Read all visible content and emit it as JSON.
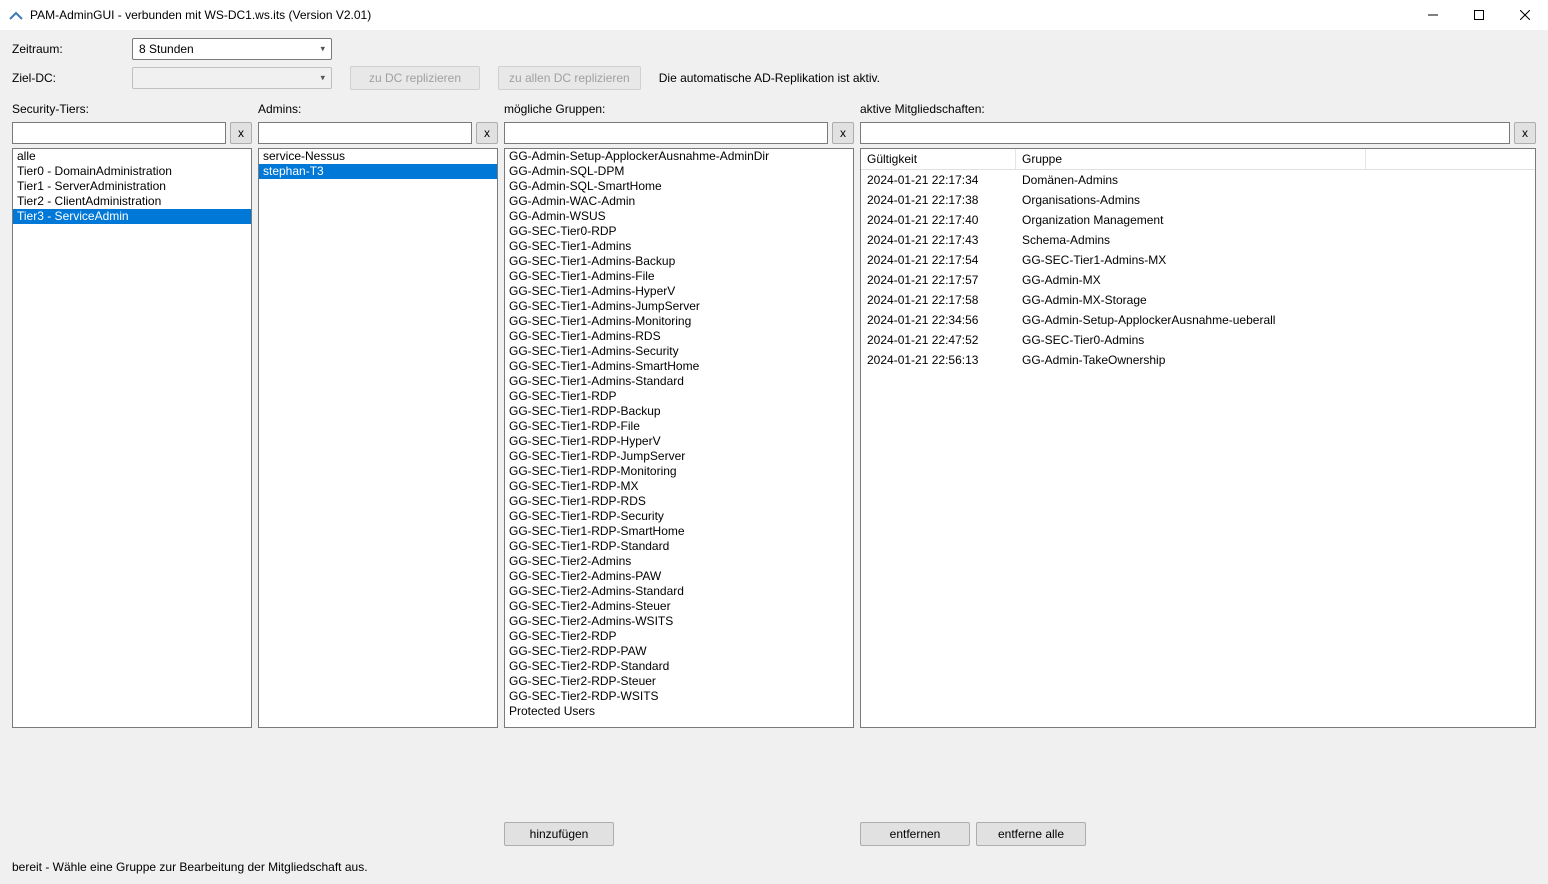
{
  "window": {
    "title": "PAM-AdminGUI - verbunden mit WS-DC1.ws.its (Version V2.01)"
  },
  "toolbar": {
    "zeitraum_label": "Zeitraum:",
    "zeitraum_value": "8 Stunden",
    "zieldc_label": "Ziel-DC:",
    "zieldc_value": "",
    "btn_replicate_one": "zu DC replizieren",
    "btn_replicate_all": "zu allen DC replizieren",
    "replication_status": "Die automatische AD-Replikation ist aktiv."
  },
  "columns": {
    "tiers": {
      "label": "Security-Tiers:",
      "clear": "x",
      "items": [
        {
          "text": "alle",
          "selected": false
        },
        {
          "text": "Tier0 - DomainAdministration",
          "selected": false
        },
        {
          "text": "Tier1 - ServerAdministration",
          "selected": false
        },
        {
          "text": "Tier2 - ClientAdministration",
          "selected": false
        },
        {
          "text": "Tier3 - ServiceAdmin",
          "selected": true
        }
      ]
    },
    "admins": {
      "label": "Admins:",
      "clear": "x",
      "items": [
        {
          "text": "service-Nessus",
          "selected": false
        },
        {
          "text": "stephan-T3",
          "selected": true
        }
      ]
    },
    "groups": {
      "label": "mögliche Gruppen:",
      "clear": "x",
      "items": [
        "GG-Admin-Setup-ApplockerAusnahme-AdminDir",
        "GG-Admin-SQL-DPM",
        "GG-Admin-SQL-SmartHome",
        "GG-Admin-WAC-Admin",
        "GG-Admin-WSUS",
        "GG-SEC-Tier0-RDP",
        "GG-SEC-Tier1-Admins",
        "GG-SEC-Tier1-Admins-Backup",
        "GG-SEC-Tier1-Admins-File",
        "GG-SEC-Tier1-Admins-HyperV",
        "GG-SEC-Tier1-Admins-JumpServer",
        "GG-SEC-Tier1-Admins-Monitoring",
        "GG-SEC-Tier1-Admins-RDS",
        "GG-SEC-Tier1-Admins-Security",
        "GG-SEC-Tier1-Admins-SmartHome",
        "GG-SEC-Tier1-Admins-Standard",
        "GG-SEC-Tier1-RDP",
        "GG-SEC-Tier1-RDP-Backup",
        "GG-SEC-Tier1-RDP-File",
        "GG-SEC-Tier1-RDP-HyperV",
        "GG-SEC-Tier1-RDP-JumpServer",
        "GG-SEC-Tier1-RDP-Monitoring",
        "GG-SEC-Tier1-RDP-MX",
        "GG-SEC-Tier1-RDP-RDS",
        "GG-SEC-Tier1-RDP-Security",
        "GG-SEC-Tier1-RDP-SmartHome",
        "GG-SEC-Tier1-RDP-Standard",
        "GG-SEC-Tier2-Admins",
        "GG-SEC-Tier2-Admins-PAW",
        "GG-SEC-Tier2-Admins-Standard",
        "GG-SEC-Tier2-Admins-Steuer",
        "GG-SEC-Tier2-Admins-WSITS",
        "GG-SEC-Tier2-RDP",
        "GG-SEC-Tier2-RDP-PAW",
        "GG-SEC-Tier2-RDP-Standard",
        "GG-SEC-Tier2-RDP-Steuer",
        "GG-SEC-Tier2-RDP-WSITS",
        "Protected Users"
      ]
    },
    "active": {
      "label": "aktive Mitgliedschaften:",
      "clear": "x",
      "th_validity": "Gültigkeit",
      "th_group": "Gruppe",
      "rows": [
        {
          "validity": "2024-01-21 22:17:34",
          "group": "Domänen-Admins"
        },
        {
          "validity": "2024-01-21 22:17:38",
          "group": "Organisations-Admins"
        },
        {
          "validity": "2024-01-21 22:17:40",
          "group": "Organization Management"
        },
        {
          "validity": "2024-01-21 22:17:43",
          "group": "Schema-Admins"
        },
        {
          "validity": "2024-01-21 22:17:54",
          "group": "GG-SEC-Tier1-Admins-MX"
        },
        {
          "validity": "2024-01-21 22:17:57",
          "group": "GG-Admin-MX"
        },
        {
          "validity": "2024-01-21 22:17:58",
          "group": "GG-Admin-MX-Storage"
        },
        {
          "validity": "2024-01-21 22:34:56",
          "group": "GG-Admin-Setup-ApplockerAusnahme-ueberall"
        },
        {
          "validity": "2024-01-21 22:47:52",
          "group": "GG-SEC-Tier0-Admins"
        },
        {
          "validity": "2024-01-21 22:56:13",
          "group": "GG-Admin-TakeOwnership"
        }
      ]
    }
  },
  "footer": {
    "btn_add": "hinzufügen",
    "btn_remove": "entfernen",
    "btn_remove_all": "entferne alle"
  },
  "status": {
    "text": "bereit - Wähle eine Gruppe zur Bearbeitung der Mitgliedschaft aus."
  }
}
